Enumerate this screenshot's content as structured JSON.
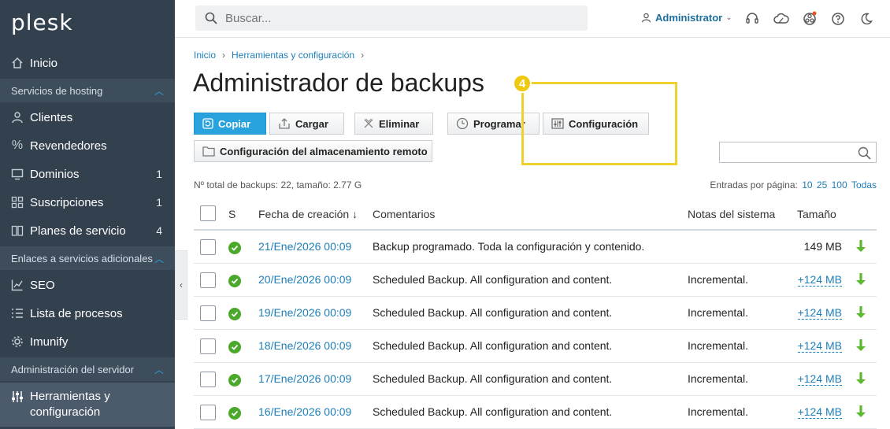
{
  "logo": "plesk",
  "sidebar": {
    "items": [
      {
        "label": "Inicio"
      },
      {
        "label": "Clientes"
      },
      {
        "label": "Revendedores"
      },
      {
        "label": "Dominios",
        "count": "1"
      },
      {
        "label": "Suscripciones",
        "count": "1"
      },
      {
        "label": "Planes de servicio",
        "count": "4"
      },
      {
        "label": "SEO"
      },
      {
        "label": "Lista de procesos"
      },
      {
        "label": "Imunify"
      },
      {
        "label": "Herramientas y",
        "label2": "configuración"
      }
    ],
    "sections": [
      {
        "label": "Servicios de hosting"
      },
      {
        "label": "Enlaces a servicios adicionales"
      },
      {
        "label": "Administración del servidor"
      }
    ]
  },
  "header": {
    "search_placeholder": "Buscar...",
    "user": "Administrator"
  },
  "breadcrumb": [
    "Inicio",
    "Herramientas y configuración"
  ],
  "page_title": "Administrador de backups",
  "step_badge": "4",
  "toolbar": {
    "copy": "Copiar",
    "upload": "Cargar",
    "delete": "Eliminar",
    "schedule": "Programar",
    "settings": "Configuración",
    "remote": "Configuración del almacenamiento remoto"
  },
  "summary": "Nº total de backups: 22, tamaño: 2.77 G",
  "perpage": {
    "label": "Entradas por página:",
    "options": [
      "10",
      "25",
      "100",
      "Todas"
    ]
  },
  "table": {
    "headers": {
      "status": "S",
      "date": "Fecha de creación ↓",
      "comments": "Comentarios",
      "notes": "Notas del sistema",
      "size": "Tamaño"
    },
    "rows": [
      {
        "date": "21/Ene/2026 00:09",
        "comment": "Backup programado. Toda la configuración y contenido.",
        "notes": "",
        "size": "149 MB"
      },
      {
        "date": "20/Ene/2026 00:09",
        "comment": "Scheduled Backup. All configuration and content.",
        "notes": "Incremental.",
        "size": "+124 MB"
      },
      {
        "date": "19/Ene/2026 00:09",
        "comment": "Scheduled Backup. All configuration and content.",
        "notes": "Incremental.",
        "size": "+124 MB"
      },
      {
        "date": "18/Ene/2026 00:09",
        "comment": "Scheduled Backup. All configuration and content.",
        "notes": "Incremental.",
        "size": "+124 MB"
      },
      {
        "date": "17/Ene/2026 00:09",
        "comment": "Scheduled Backup. All configuration and content.",
        "notes": "Incremental.",
        "size": "+124 MB"
      },
      {
        "date": "16/Ene/2026 00:09",
        "comment": "Scheduled Backup. All configuration and content.",
        "notes": "Incremental.",
        "size": "+124 MB"
      }
    ]
  },
  "colors": {
    "sidebar": "#33414f",
    "accent": "#28a3dd",
    "link": "#1d7eb8",
    "highlight": "#f0d02c",
    "ok": "#4aa82a"
  }
}
